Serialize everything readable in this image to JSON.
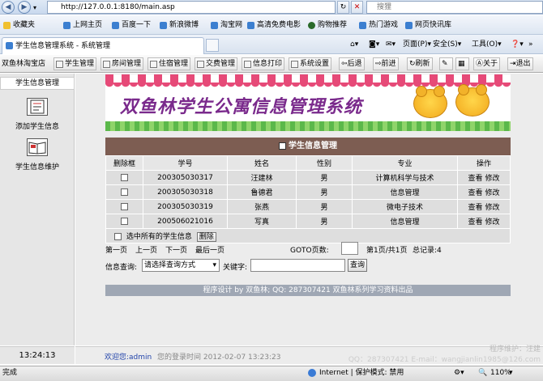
{
  "browser": {
    "url": "http://127.0.0.1:8180/main.asp",
    "search_placeholder": "搜狸",
    "tab_title": "学生信息管理系统 - 系统管理",
    "favorites": [
      "收藏夹",
      "上网主页",
      "百度一下",
      "新浪微博",
      "淘宝网",
      "高清免费电影",
      "购物推荐",
      "热门游戏",
      "网页快讯库"
    ],
    "commands": [
      "页面(P)",
      "安全(S)",
      "工具(O)"
    ],
    "status_left": "完成",
    "status_zone": "Internet | 保护模式: 禁用",
    "zoom": "110%"
  },
  "toolbar": {
    "store": "双鱼林淘宝店",
    "items": [
      "学生管理",
      "房间管理",
      "住宿管理",
      "交费管理",
      "信息打印",
      "系统设置",
      "后退",
      "前进",
      "刷新",
      "关于",
      "退出"
    ]
  },
  "sidebar": {
    "title": "学生信息管理",
    "add_label": "添加学生信息",
    "maintain_label": "学生信息维护"
  },
  "banner": {
    "title": "双鱼林学生公寓信息管理系统"
  },
  "grid": {
    "title": "学生信息管理",
    "headers": [
      "删除框",
      "学号",
      "姓名",
      "性别",
      "专业",
      "操作"
    ],
    "rows": [
      {
        "id": "200305030317",
        "name": "汪建林",
        "sex": "男",
        "major": "计算机科学与技术"
      },
      {
        "id": "200305030318",
        "name": "鲁德君",
        "sex": "男",
        "major": "信息管理"
      },
      {
        "id": "200305030319",
        "name": "张燕",
        "sex": "男",
        "major": "微电子技术"
      },
      {
        "id": "200506021016",
        "name": "写真",
        "sex": "男",
        "major": "信息管理"
      }
    ],
    "view_label": "查看",
    "edit_label": "修改",
    "select_all_label": "选中所有的学生信息",
    "delete_label": "删除"
  },
  "pager": {
    "first": "第一页",
    "prev": "上一页",
    "next": "下一页",
    "last": "最后一页",
    "goto_label": "GOTO页数:",
    "page_info": "第1页/共1页",
    "records": "总记录:4"
  },
  "query": {
    "label": "信息查询:",
    "select_value": "请选择查询方式",
    "keyword_label": "关键字:",
    "button": "查询"
  },
  "footer": {
    "text": "程序设计 by 双鱼林; QQ: 287307421 双鱼林系列学习资料出品"
  },
  "bottom": {
    "time": "13:24:13",
    "welcome": "欢迎您:admin",
    "login_time": "您的登录时间 2012-02-07 13:23:23",
    "maintainer": "程序维护：汪建",
    "contact": "QQ：287307421 E-mail：wangjianlin1985@126.com"
  }
}
